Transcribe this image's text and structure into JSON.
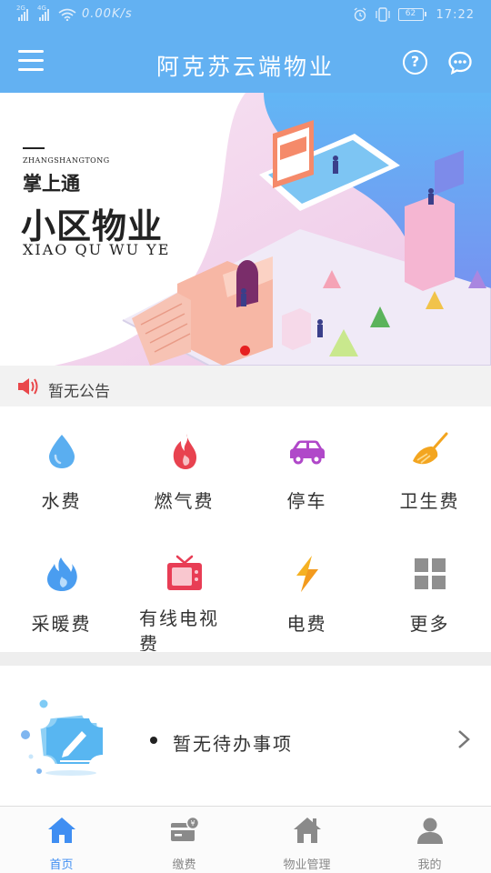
{
  "status_bar": {
    "network_left": "2G",
    "network_right": "4G",
    "speed": "0.00K/s",
    "battery": "62",
    "time": "17:22"
  },
  "header": {
    "title": "阿克苏云端物业",
    "menu_icon": "menu-icon",
    "help_icon": "help-icon",
    "message_icon": "message-icon"
  },
  "banner": {
    "pinyin_small": "ZHANGSHANGTONG",
    "title_small": "掌上通",
    "title_big": "小区物业",
    "pinyin_big": "XIAO QU WU YE",
    "carousel_dots": 1,
    "active_dot_color": "#e62020"
  },
  "notice": {
    "icon": "speaker-icon",
    "text": "暂无公告"
  },
  "services": [
    {
      "label": "水费",
      "icon": "water-drop-icon",
      "color": "#5aaef0"
    },
    {
      "label": "燃气费",
      "icon": "flame-icon",
      "color": "#e8424f"
    },
    {
      "label": "停车",
      "icon": "car-icon",
      "color": "#b048c9"
    },
    {
      "label": "卫生费",
      "icon": "broom-icon",
      "color": "#f3a51f"
    },
    {
      "label": "采暖费",
      "icon": "heating-flame-icon",
      "color": "#4a9df0"
    },
    {
      "label": "有线电视费",
      "icon": "tv-icon",
      "color": "#e83d55"
    },
    {
      "label": "电费",
      "icon": "lightning-icon",
      "color": "#f5b122"
    },
    {
      "label": "更多",
      "icon": "grid-more-icon",
      "color": "#8f8f8f"
    }
  ],
  "todo": {
    "icon": "ticket-edit-icon",
    "text": "暂无待办事项",
    "chevron_icon": "chevron-right-icon"
  },
  "bottom_nav": [
    {
      "label": "首页",
      "icon": "home-icon",
      "active": true
    },
    {
      "label": "缴费",
      "icon": "payment-card-icon",
      "active": false
    },
    {
      "label": "物业管理",
      "icon": "property-house-icon",
      "active": false
    },
    {
      "label": "我的",
      "icon": "user-icon",
      "active": false
    }
  ],
  "colors": {
    "brand": "#63b1f2",
    "active_nav": "#3f8ef2",
    "inactive_nav": "#888888"
  }
}
